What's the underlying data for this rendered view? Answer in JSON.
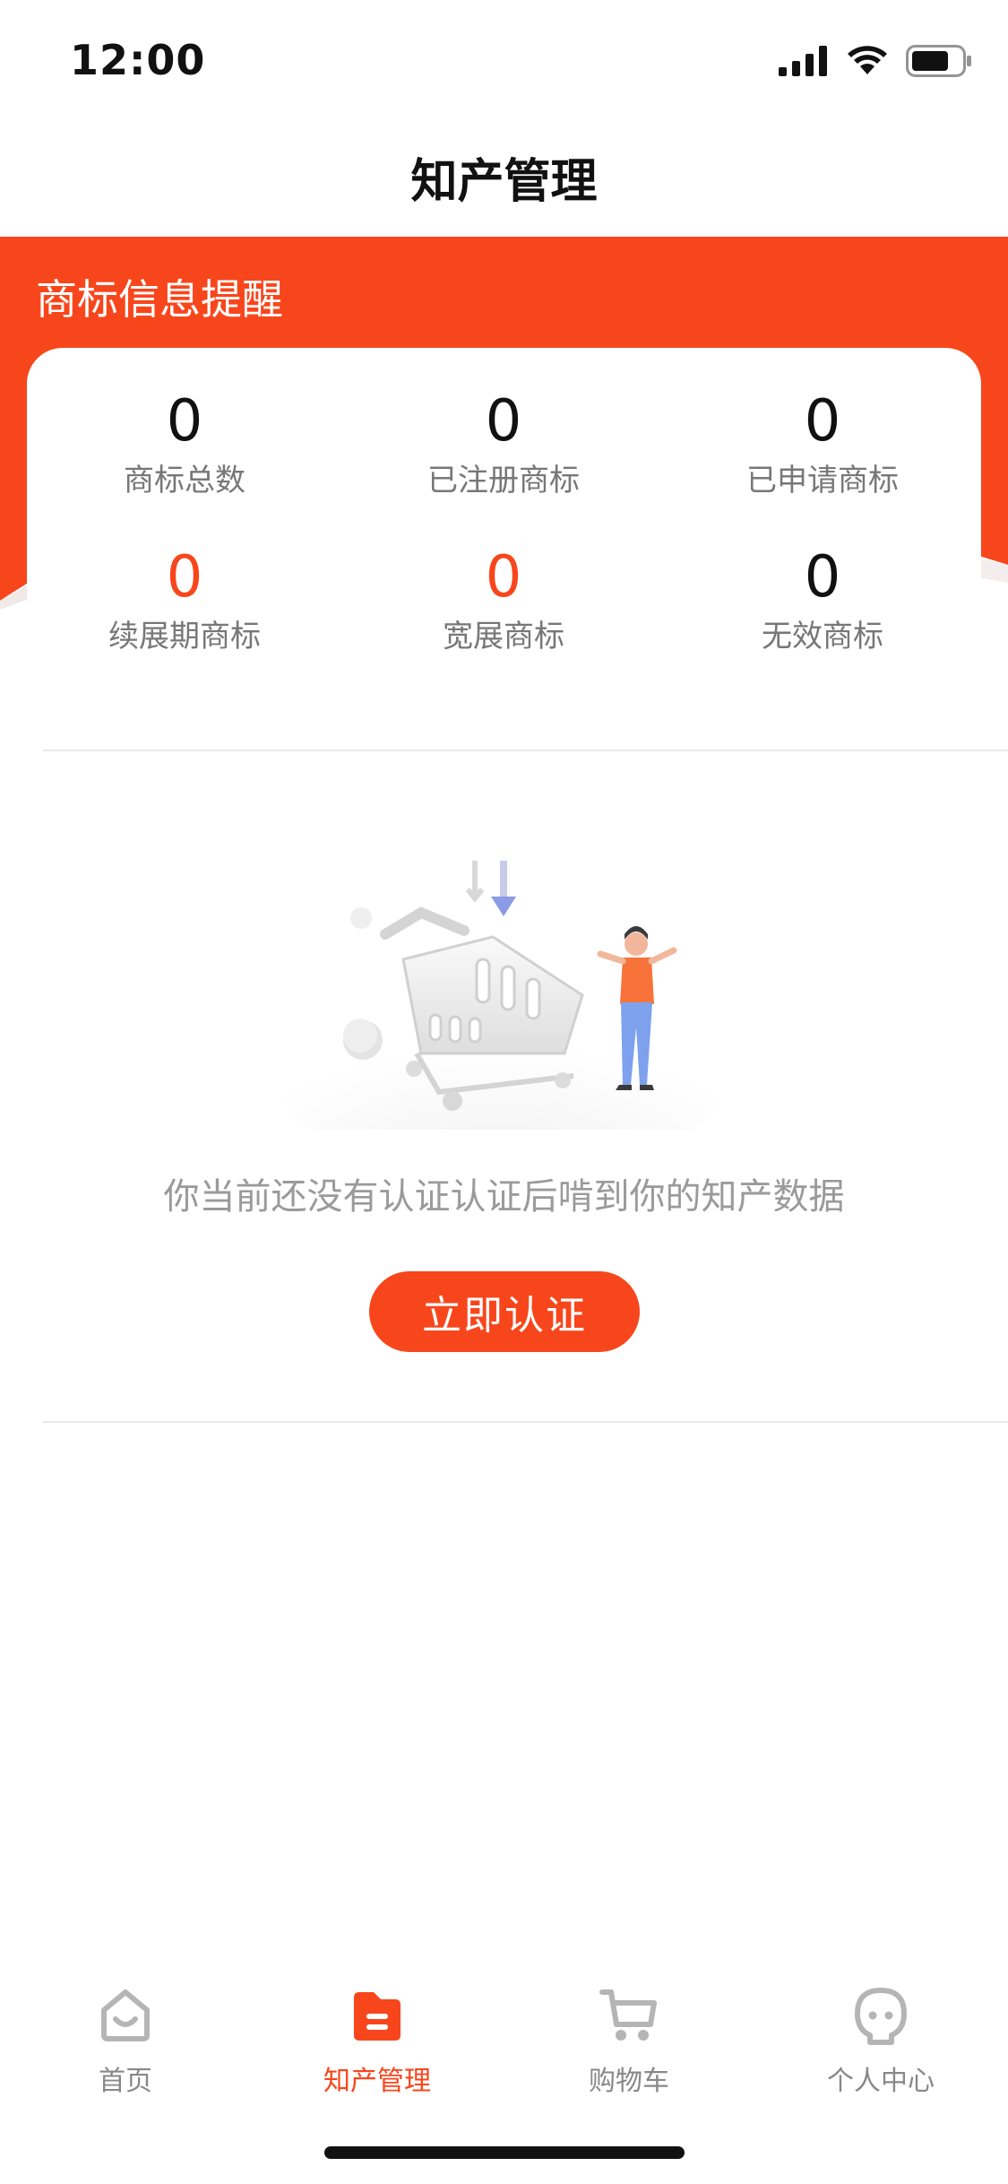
{
  "status_bar": {
    "time": "12:00"
  },
  "nav": {
    "title": "知产管理"
  },
  "header": {
    "label": "商标信息提醒"
  },
  "stats": [
    {
      "value": "0",
      "label": "商标总数",
      "highlight": false
    },
    {
      "value": "0",
      "label": "已注册商标",
      "highlight": false
    },
    {
      "value": "0",
      "label": "已申请商标",
      "highlight": false
    },
    {
      "value": "0",
      "label": "续展期商标",
      "highlight": true
    },
    {
      "value": "0",
      "label": "宽展商标",
      "highlight": true
    },
    {
      "value": "0",
      "label": "无效商标",
      "highlight": false
    }
  ],
  "empty_state": {
    "message": "你当前还没有认证认证后啃到你的知产数据",
    "button_label": "立即认证"
  },
  "tabs": [
    {
      "label": "首页",
      "icon": "home-icon",
      "active": false
    },
    {
      "label": "知产管理",
      "icon": "folder-icon",
      "active": true
    },
    {
      "label": "购物车",
      "icon": "cart-icon",
      "active": false
    },
    {
      "label": "个人中心",
      "icon": "profile-icon",
      "active": false
    }
  ],
  "colors": {
    "accent": "#f8461c",
    "muted_text": "#9a9a9a",
    "inactive_tab": "#b5b5b5"
  }
}
